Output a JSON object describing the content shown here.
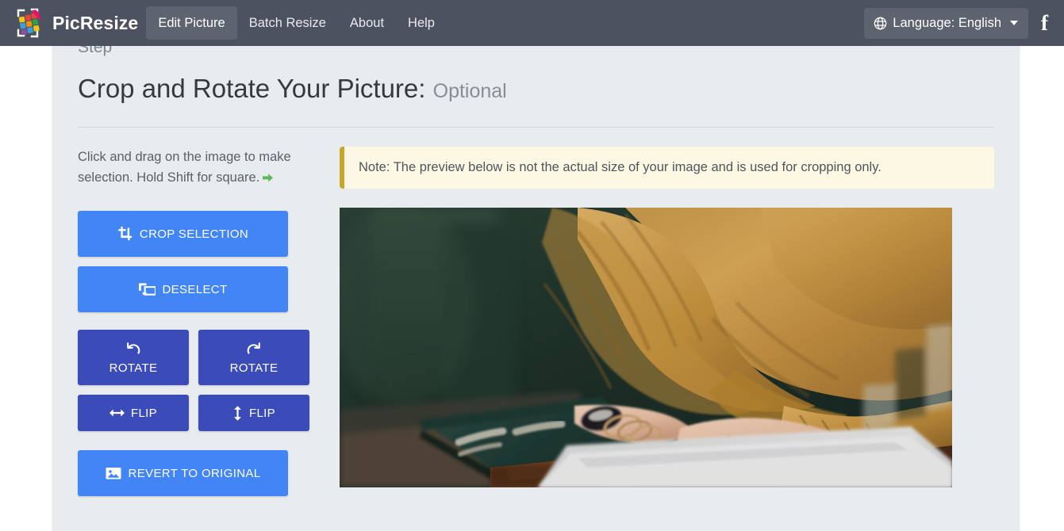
{
  "navbar": {
    "brand_name": "PicResize",
    "logo_icon": "picresize-crop-squares-logo",
    "links": [
      {
        "label": "Edit Picture",
        "active": true
      },
      {
        "label": "Batch Resize",
        "active": false
      },
      {
        "label": "About",
        "active": false
      },
      {
        "label": "Help",
        "active": false
      }
    ],
    "language_button": {
      "icon": "globe-icon",
      "label": "Language: English",
      "caret_icon": "chevron-down-icon"
    },
    "facebook_icon": "facebook-icon",
    "facebook_glyph": "f",
    "bg_color": "#4c525f",
    "active_bg_color": "#5d646f"
  },
  "page": {
    "step_ghost_text": "Step",
    "title_main": "Crop and Rotate Your Picture:",
    "title_optional": "Optional",
    "card_bg": "#e9ecef"
  },
  "sidebar": {
    "hint_text": "Click and drag on the image to make selection. Hold Shift for square.",
    "hint_arrow_icon": "green-arrow-right-icon",
    "buttons": [
      {
        "label": "CROP SELECTION",
        "icon": "crop-icon",
        "color": "#4285f4"
      },
      {
        "label": "DESELECT",
        "icon": "deselect-icon",
        "color": "#4285f4"
      },
      {
        "label": "ROTATE",
        "icon": "rotate-left-icon",
        "color": "#3b4cb8"
      },
      {
        "label": "ROTATE",
        "icon": "rotate-right-icon",
        "color": "#3b4cb8"
      },
      {
        "label": "FLIP",
        "icon": "flip-horizontal-icon",
        "color": "#3b4cb8"
      },
      {
        "label": "FLIP",
        "icon": "flip-vertical-icon",
        "color": "#3b4cb8"
      },
      {
        "label": "REVERT TO ORIGINAL",
        "icon": "image-icon",
        "color": "#4285f4"
      }
    ]
  },
  "main": {
    "note_text": "Note: The preview below is not the actual size of your image and is used for cropping only.",
    "note_bg": "#fcf8e3",
    "note_accent": "#c9a52c",
    "preview_image_alt": "Person in mustard knit sweater typing on a white laptop at a wooden desk"
  }
}
